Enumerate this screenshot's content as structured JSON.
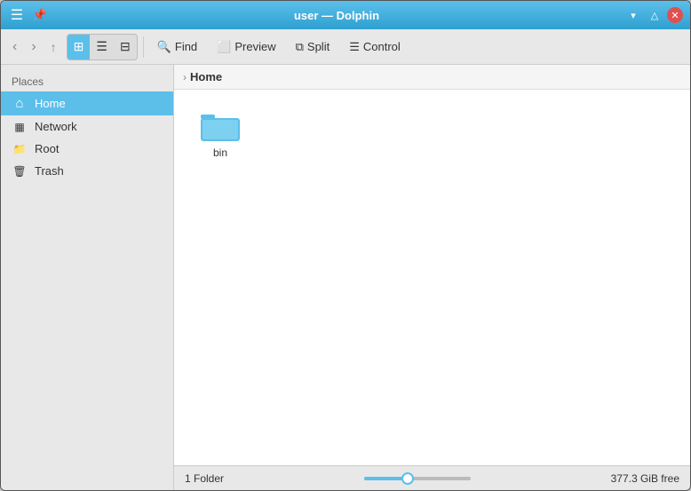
{
  "window": {
    "title": "user — Dolphin"
  },
  "titlebar": {
    "title": "user — Dolphin",
    "menu_icon": "☰",
    "pin_icon": "📌",
    "btn_minimize": "▾",
    "btn_maximize": "▵",
    "btn_close": "✕"
  },
  "toolbar": {
    "back_label": "‹",
    "forward_label": "›",
    "up_label": "↑",
    "view_icons_label": "⊞",
    "view_compact_label": "☰",
    "view_tree_label": "⊟",
    "find_label": "Find",
    "preview_label": "Preview",
    "split_label": "Split",
    "control_label": "Control"
  },
  "sidebar": {
    "section_label": "Places",
    "items": [
      {
        "id": "home",
        "label": "Home",
        "icon": "⌂",
        "active": true
      },
      {
        "id": "network",
        "label": "Network",
        "icon": "⊞",
        "active": false
      },
      {
        "id": "root",
        "label": "Root",
        "icon": "📁",
        "active": false
      },
      {
        "id": "trash",
        "label": "Trash",
        "icon": "🗑",
        "active": false
      }
    ]
  },
  "breadcrumb": {
    "arrow": "›",
    "current": "Home"
  },
  "files": [
    {
      "name": "bin",
      "type": "folder"
    }
  ],
  "statusbar": {
    "folder_count": "1 Folder",
    "free_space": "377.3 GiB free",
    "slider_value": 40
  }
}
